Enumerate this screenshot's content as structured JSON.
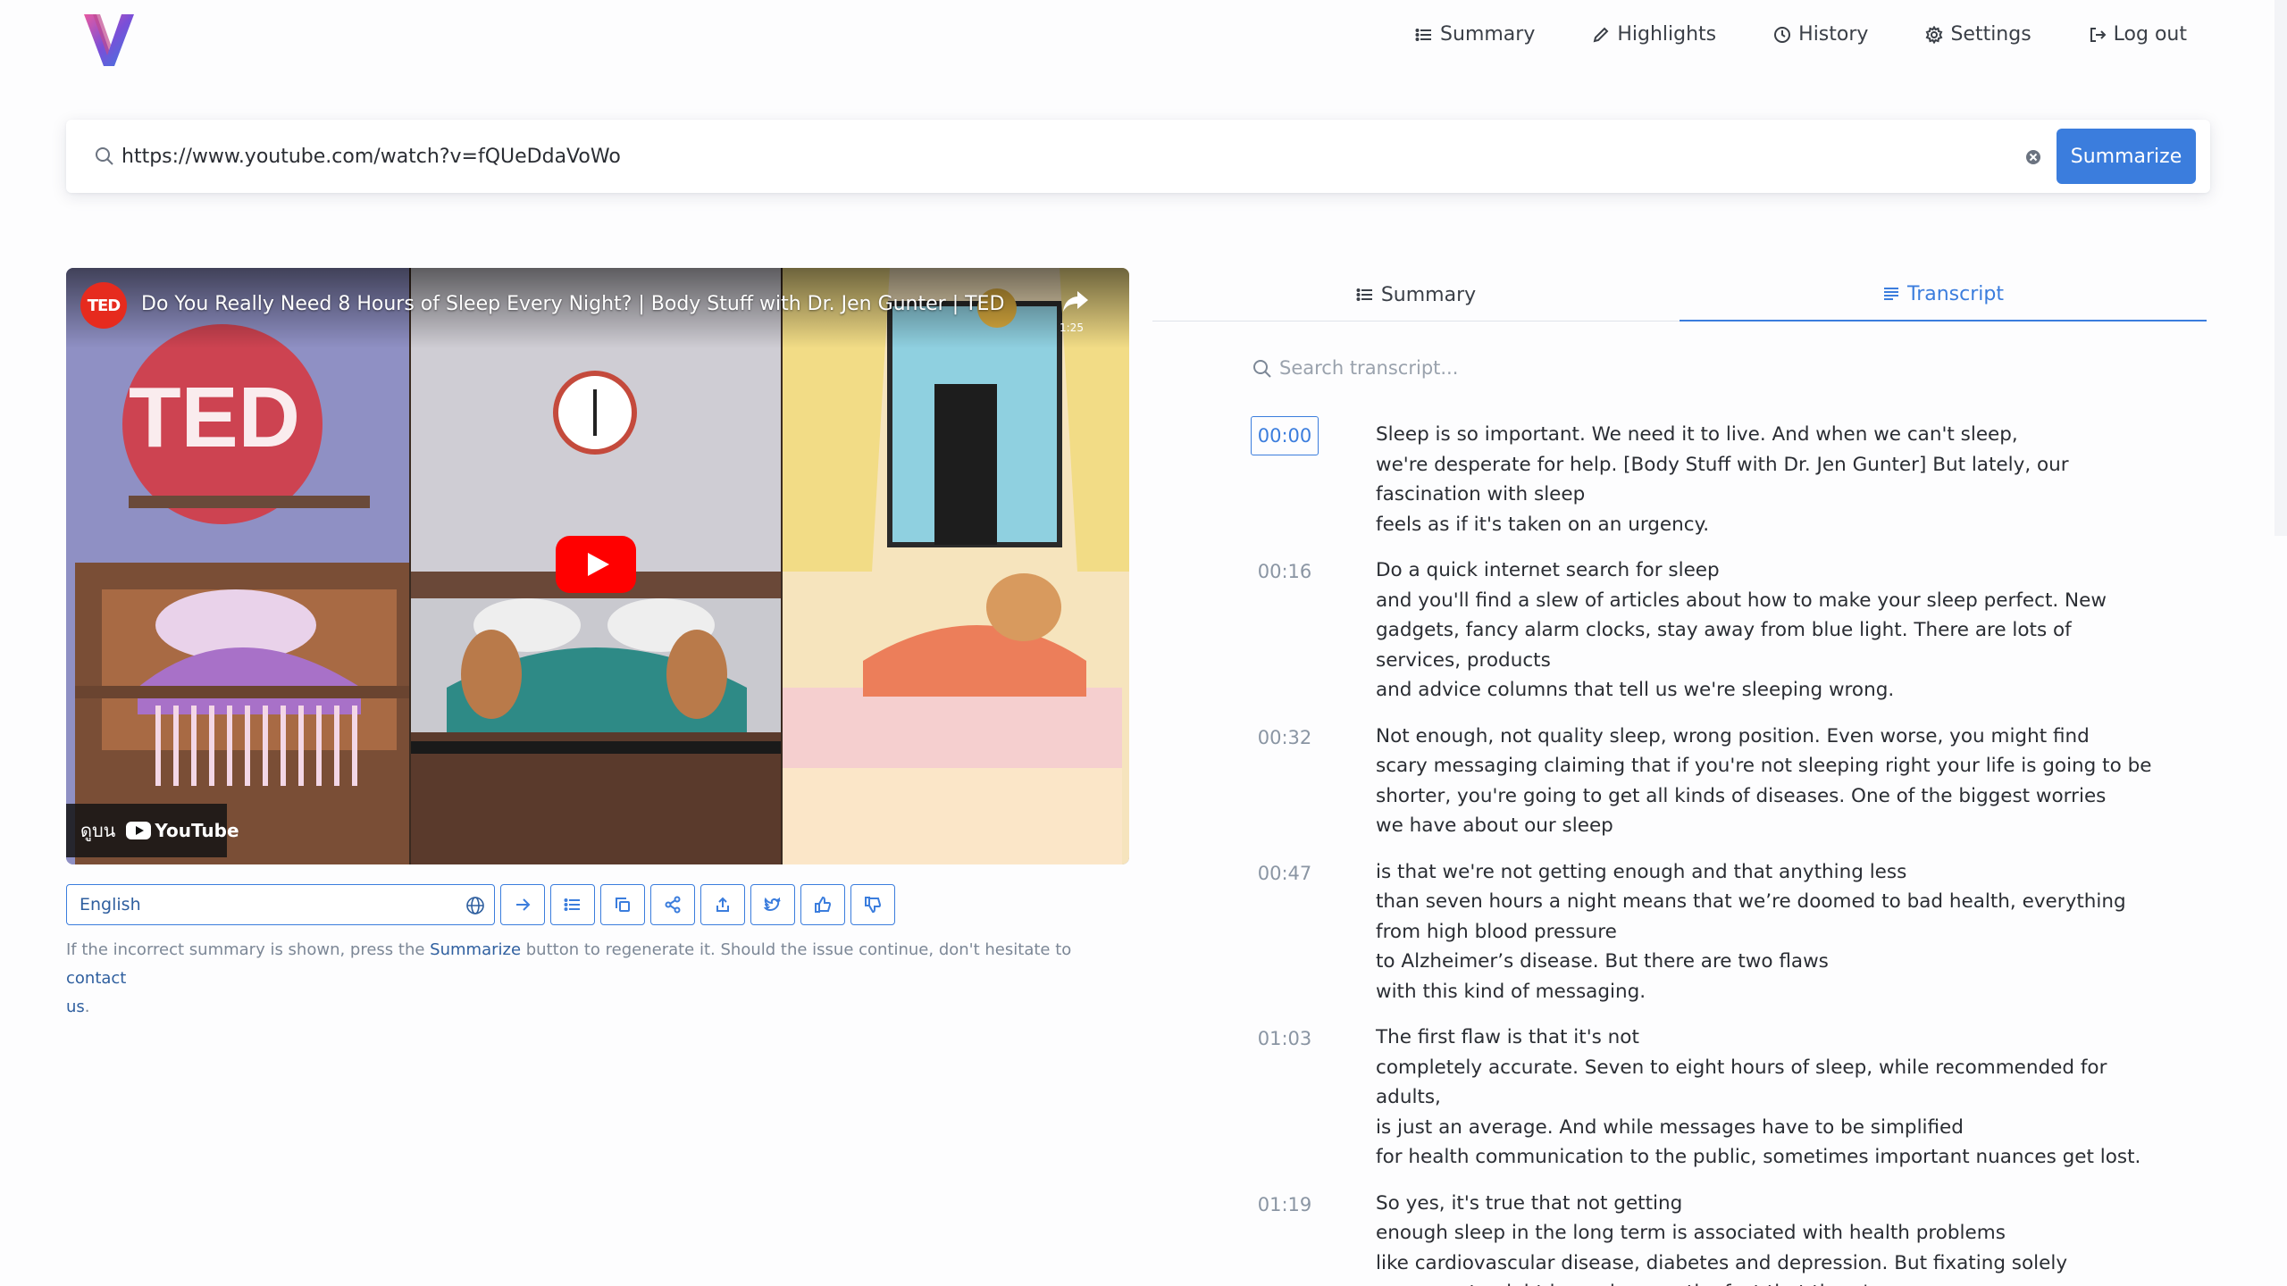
{
  "nav": {
    "items": [
      {
        "label": "Summary",
        "icon": "list-icon"
      },
      {
        "label": "Highlights",
        "icon": "pencil-icon"
      },
      {
        "label": "History",
        "icon": "clock-icon"
      },
      {
        "label": "Settings",
        "icon": "gear-icon"
      },
      {
        "label": "Log out",
        "icon": "logout-icon"
      }
    ]
  },
  "url_bar": {
    "value": "https://www.youtube.com/watch?v=fQUeDdaVoWo",
    "button_label": "Summarize"
  },
  "video": {
    "channel_badge": "TED",
    "title": "Do You Really Need 8 Hours of Sleep Every Night? | Body Stuff with Dr. Jen Gunter | TED",
    "share_count": "1:25",
    "watch_on": "ดูบน",
    "platform": "YouTube"
  },
  "toolbar": {
    "language": "English"
  },
  "notice": {
    "part1": "If the incorrect summary is shown, press the ",
    "link1": "Summarize",
    "part2": " button to regenerate it. Should the issue continue, don't hesitate to ",
    "link2": "contact",
    "link3": "us",
    "part3": "."
  },
  "tabs": {
    "summary": "Summary",
    "transcript": "Transcript"
  },
  "transcript_search": {
    "placeholder": "Search transcript..."
  },
  "transcript": [
    {
      "time": "00:00",
      "lines": [
        "Sleep is so important. We need it to live. And when we can't sleep,",
        "we're desperate for help. [Body Stuff with Dr. Jen Gunter] But lately, our",
        "fascination with sleep",
        "feels as if it's taken on an urgency."
      ]
    },
    {
      "time": "00:16",
      "lines": [
        "Do a quick internet search for sleep",
        "and you'll find a slew of articles about how to make your sleep perfect. New",
        "gadgets, fancy alarm clocks, stay away from blue light. There are lots of",
        "services, products",
        "and advice columns that tell us we're sleeping wrong."
      ]
    },
    {
      "time": "00:32",
      "lines": [
        "Not enough, not quality sleep, wrong position. Even worse, you might find",
        "scary messaging claiming that if you're not sleeping right your life is going to be",
        "shorter, you're going to get all kinds of diseases. One of the biggest worries",
        "we have about our sleep"
      ]
    },
    {
      "time": "00:47",
      "lines": [
        "is that we're not getting enough and that anything less",
        "than seven hours a night means that we’re doomed to bad health, everything",
        "from high blood pressure",
        "to Alzheimer’s disease. But there are two flaws",
        "with this kind of messaging."
      ]
    },
    {
      "time": "01:03",
      "lines": [
        "The first flaw is that it's not",
        "completely accurate. Seven to eight hours of sleep, while recommended for",
        "adults,",
        "is just an average. And while messages have to be simplified",
        "for health communication to the public, sometimes important nuances get lost."
      ]
    },
    {
      "time": "01:19",
      "lines": [
        "So yes, it's true that not getting",
        "enough sleep in the long term is associated with health problems",
        "like cardiovascular disease, diabetes and depression. But fixating solely",
        "on seven to eight hours ignores the fact that there's a range"
      ]
    }
  ],
  "colors": {
    "accent": "#3b7ddd",
    "ted_red": "#e62b1e",
    "youtube_red": "#ff0000"
  }
}
